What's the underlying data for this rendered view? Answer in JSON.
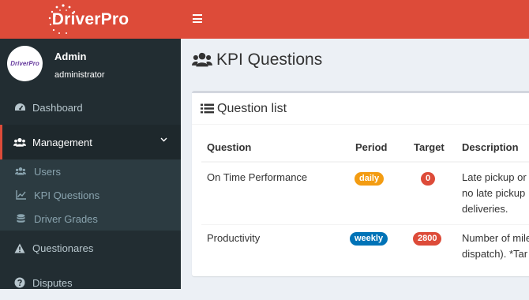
{
  "brand": {
    "name": "DriverPro",
    "avatar_text": "DriverPro"
  },
  "user": {
    "name": "Admin",
    "role": "administrator"
  },
  "sidebar": {
    "items": [
      {
        "label": "Dashboard",
        "icon": "dashboard-icon"
      },
      {
        "label": "Management",
        "icon": "users-icon",
        "expanded": true
      },
      {
        "label": "Questionares",
        "icon": "warning-icon"
      },
      {
        "label": "Disputes",
        "icon": "question-circle-icon"
      }
    ],
    "submenu": [
      {
        "label": "Users",
        "icon": "users-icon"
      },
      {
        "label": "KPI Questions",
        "icon": "line-chart-icon"
      },
      {
        "label": "Driver Grades",
        "icon": "database-icon"
      }
    ]
  },
  "page": {
    "title": "KPI Questions"
  },
  "box": {
    "title": "Question list"
  },
  "table": {
    "headers": [
      "Question",
      "Period",
      "Target",
      "Description"
    ],
    "rows": [
      {
        "question": "On Time Performance",
        "period": "daily",
        "target": "0",
        "description_lines": [
          "Late pickup or",
          "no late pickup",
          "deliveries."
        ]
      },
      {
        "question": "Productivity",
        "period": "weekly",
        "target": "2800",
        "description_lines": [
          "Number of mile",
          "dispatch). *Tar"
        ]
      }
    ]
  },
  "colors": {
    "brand_red": "#dd4b39",
    "sidebar_dark": "#222d32",
    "badge_daily": "#f39c12",
    "badge_weekly": "#0073b7",
    "badge_target": "#dd4b39"
  }
}
